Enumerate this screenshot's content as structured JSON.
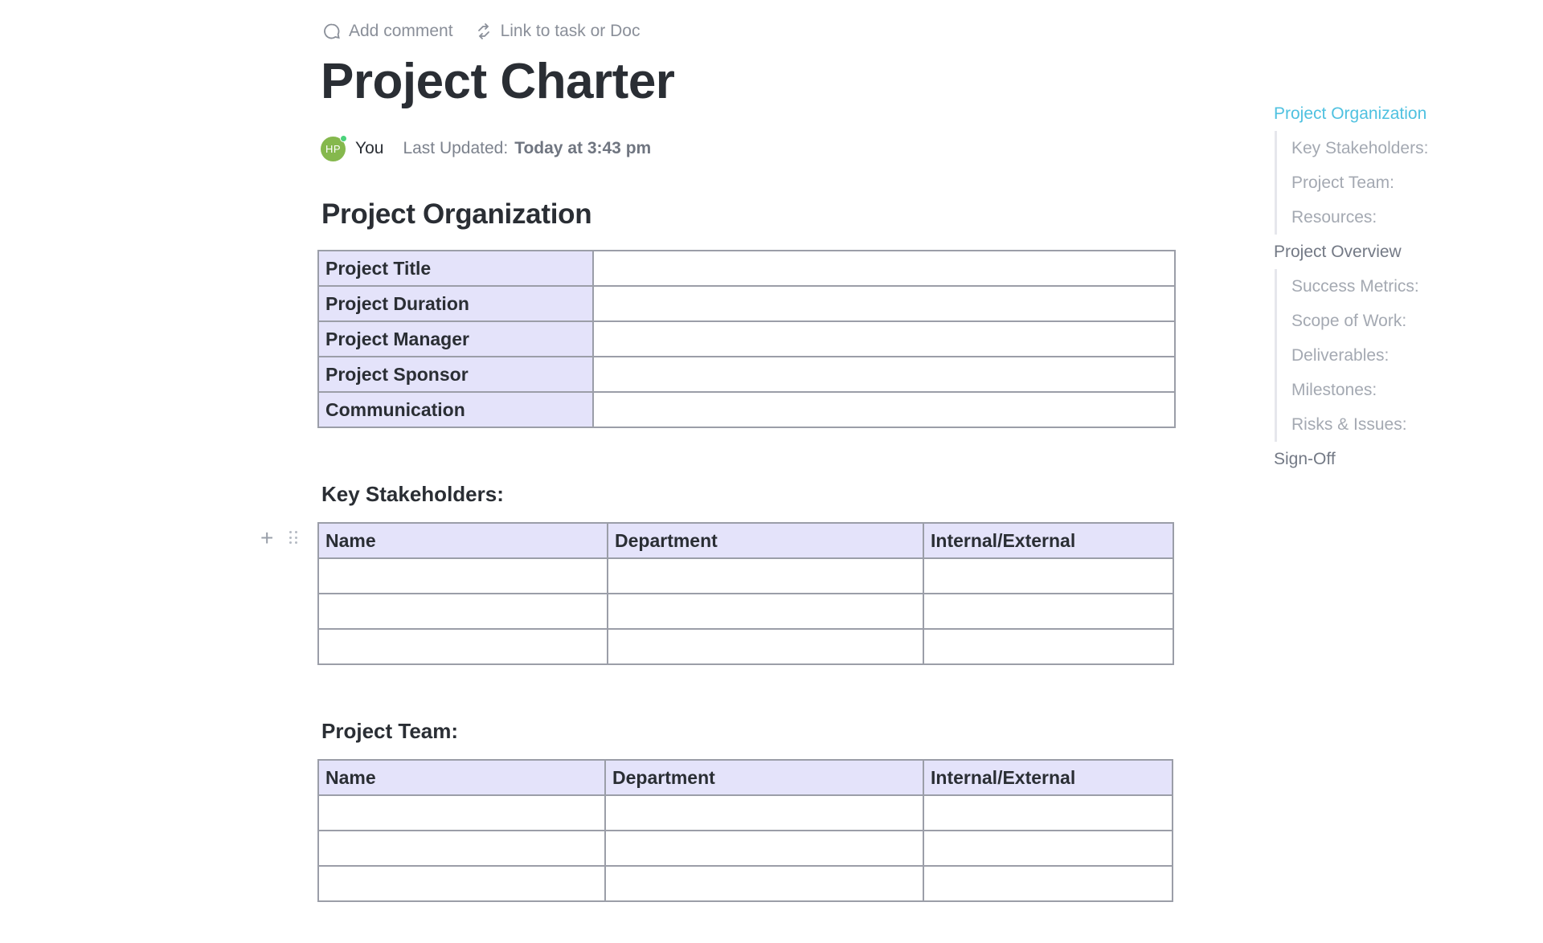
{
  "toolbar": {
    "add_comment": "Add comment",
    "link_task": "Link to task or Doc",
    "icons": {
      "comment": "comment-icon",
      "link": "link-arrows-icon"
    }
  },
  "doc": {
    "title": "Project Charter",
    "author": {
      "initials": "HP",
      "name": "You",
      "avatar_color": "#85b84d",
      "presence_color": "#4bd37b"
    },
    "last_updated_label": "Last Updated:",
    "last_updated_value": "Today at 3:43 pm"
  },
  "sections": {
    "organization": {
      "heading": "Project Organization",
      "rows": [
        {
          "label": "Project Title",
          "value": ""
        },
        {
          "label": "Project Duration",
          "value": ""
        },
        {
          "label": "Project Manager",
          "value": ""
        },
        {
          "label": "Project Sponsor",
          "value": ""
        },
        {
          "label": "Communication",
          "value": ""
        }
      ]
    },
    "stakeholders": {
      "heading": "Key Stakeholders:",
      "columns": [
        "Name",
        "Department",
        "Internal/External"
      ],
      "rows": [
        [
          "",
          "",
          ""
        ],
        [
          "",
          "",
          ""
        ],
        [
          "",
          "",
          ""
        ]
      ]
    },
    "team": {
      "heading": "Project Team:",
      "columns": [
        "Name",
        "Department",
        "Internal/External"
      ],
      "rows": [
        [
          "",
          "",
          ""
        ],
        [
          "",
          "",
          ""
        ],
        [
          "",
          "",
          ""
        ]
      ]
    }
  },
  "block_tools": {
    "add": "+",
    "icons": {
      "add": "plus-icon",
      "drag": "drag-handle-icon"
    }
  },
  "toc": {
    "active_color": "#4fc1e0",
    "items": [
      {
        "label": "Project Organization",
        "active": true,
        "children": [
          "Key Stakeholders:",
          "Project Team:",
          "Resources:"
        ]
      },
      {
        "label": "Project Overview",
        "active": false,
        "children": [
          "Success Metrics:",
          "Scope of Work:",
          "Deliverables:",
          "Milestones:",
          "Risks & Issues:"
        ]
      },
      {
        "label": "Sign-Off",
        "active": false,
        "children": []
      }
    ]
  }
}
